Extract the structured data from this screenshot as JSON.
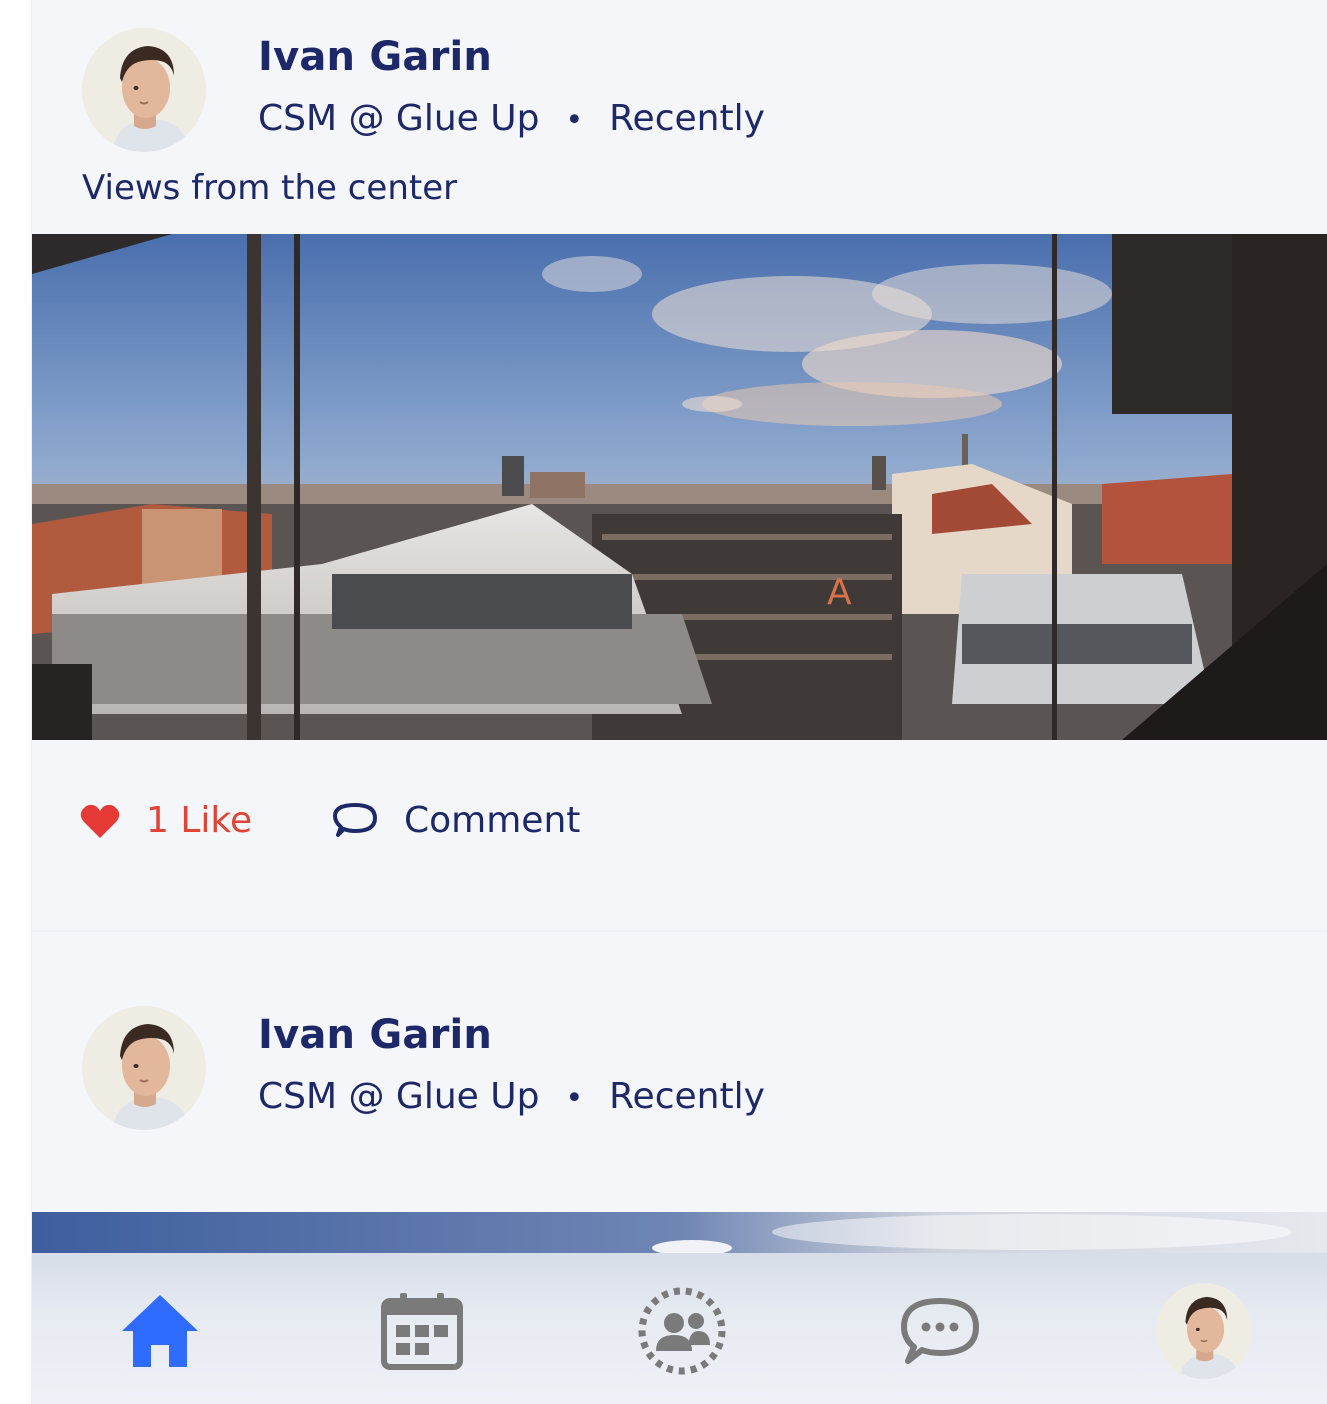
{
  "posts": [
    {
      "author": "Ivan Garin",
      "role": "CSM @ Glue Up",
      "separator": "•",
      "time": "Recently",
      "caption": "Views from the center",
      "likes_label": "1 Like",
      "comment_label": "Comment"
    },
    {
      "author": "Ivan Garin",
      "role": "CSM @ Glue Up",
      "separator": "•",
      "time": "Recently"
    }
  ],
  "colors": {
    "like": "#e04434",
    "text": "#1d2868",
    "active_tab": "#2f6bff",
    "inactive_tab": "#7a7a7a"
  },
  "tabbar": {
    "tabs": [
      {
        "icon": "home-icon",
        "active": true
      },
      {
        "icon": "calendar-icon",
        "active": false
      },
      {
        "icon": "community-icon",
        "active": false
      },
      {
        "icon": "chat-icon",
        "active": false
      },
      {
        "icon": "profile-avatar",
        "active": false
      }
    ]
  }
}
